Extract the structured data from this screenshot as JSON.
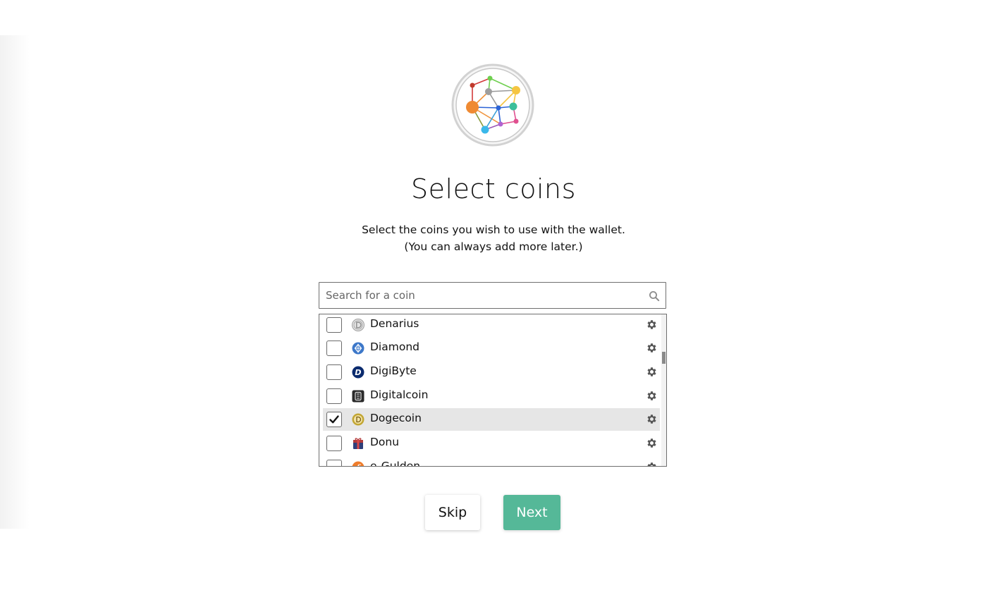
{
  "header": {
    "title": "Select coins",
    "subtitle_line1": "Select the coins you wish to use with the wallet.",
    "subtitle_line2": "(You can always add more later.)"
  },
  "search": {
    "placeholder": "Search for a coin",
    "value": "",
    "icon": "search-icon"
  },
  "coins": [
    {
      "name": "Denarius",
      "checked": false,
      "icon": "denarius-coin-icon",
      "color": "#9e9e9e"
    },
    {
      "name": "Diamond",
      "checked": false,
      "icon": "diamond-coin-icon",
      "color": "#3d78c9"
    },
    {
      "name": "DigiByte",
      "checked": false,
      "icon": "digibyte-coin-icon",
      "color": "#0b2b6e"
    },
    {
      "name": "Digitalcoin",
      "checked": false,
      "icon": "digitalcoin-coin-icon",
      "color": "#2a2a2a"
    },
    {
      "name": "Dogecoin",
      "checked": true,
      "icon": "dogecoin-coin-icon",
      "color": "#c2a633"
    },
    {
      "name": "Donu",
      "checked": false,
      "icon": "donu-coin-icon",
      "color": "#b33a3a"
    },
    {
      "name": "e-Gulden",
      "checked": false,
      "icon": "egulden-coin-icon",
      "color": "#ef7d2c"
    }
  ],
  "actions": {
    "skip_label": "Skip",
    "next_label": "Next"
  },
  "colors": {
    "accent": "#55b898",
    "selected_row": "#e6e6e6"
  }
}
